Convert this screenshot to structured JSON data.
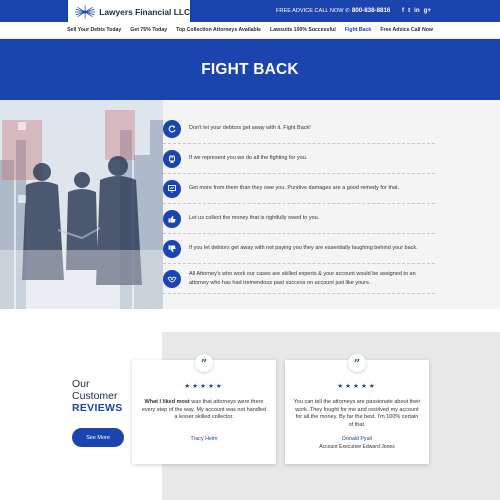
{
  "header": {
    "brand": "Lawyers Financial LLC",
    "advice_label": "FREE ADVICE CALL NOW",
    "phone": "800-838-8816",
    "socials": [
      "f",
      "t",
      "in",
      "g+"
    ]
  },
  "nav": {
    "items": [
      {
        "label": "Sell Your Debts Today"
      },
      {
        "label": "Get 75% Today"
      },
      {
        "label": "Top Collection Attorneys Available"
      },
      {
        "label": "Lawsuits 100% Successful"
      },
      {
        "label": "Fight Back"
      },
      {
        "label": "Free Advice Call Now"
      }
    ],
    "active_index": 4
  },
  "hero": {
    "title": "FIGHT BACK"
  },
  "features": [
    {
      "icon": "refresh-icon",
      "text": "Don't let your debtors get away with it. Fight Back!"
    },
    {
      "icon": "fist-icon",
      "text": "If we represent you we do all the fighting for you."
    },
    {
      "icon": "presentation-icon",
      "text": "Get more from them than they owe you. Punitive damages are a good remedy for that."
    },
    {
      "icon": "thumbs-up-icon",
      "text": "Let us collect the money that is rightfully owed to you."
    },
    {
      "icon": "thumbs-down-icon",
      "text": "If you let debtors get away with not paying you they are essentially laughing behind your back."
    },
    {
      "icon": "handshake-icon",
      "text": "All Attorney's who work our cases are skilled experts & your account would be assigned to an attorney who has had tremendous past success on account just like yours."
    }
  ],
  "reviews": {
    "heading_line1": "Our",
    "heading_line2": "Customer",
    "heading_line3": "REVIEWS",
    "see_more": "See More",
    "stars": "★★★★★",
    "quote_mark": "”",
    "cards": [
      {
        "text_bold": "What I liked most",
        "text_rest": " was that attorneys were there every step of the way. My account was not handled a lesser skilled collector.",
        "name": "Tracy Helm",
        "role": ""
      },
      {
        "text_bold": "",
        "text_rest": "You can tell the attorneys are passionate about their work. They fought for me and resolved my account for all the money. By far the best. I'm 100% certain of that.",
        "name": "Donald Pyall",
        "role": "Account Executive Edward Jones"
      }
    ]
  },
  "colors": {
    "accent": "#1b44ae",
    "feature_bg": "#f4f4f4",
    "reviews_bg": "#e8e8e8"
  }
}
